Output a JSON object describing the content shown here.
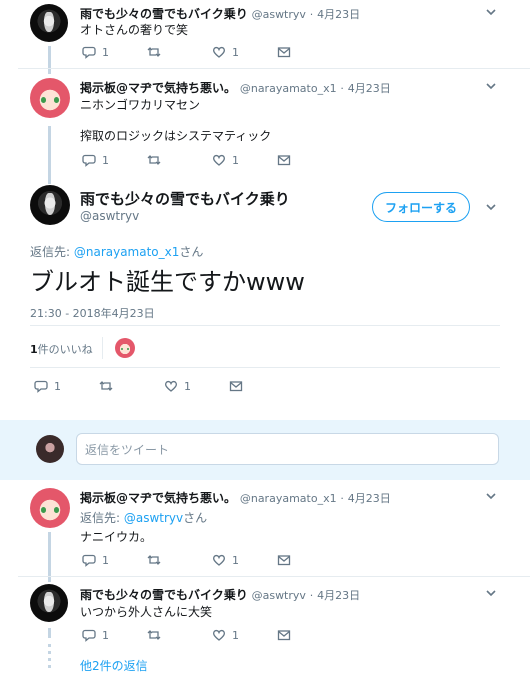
{
  "tweet1": {
    "name": "雨でも少々の雪でもバイク乗り",
    "handle": "@aswtryv",
    "date": "4月23日",
    "text": "オトさんの奢りで笑",
    "replies": "1",
    "likes": "1"
  },
  "tweet2": {
    "name": "掲示板@マヂで気持ち悪い。",
    "handle": "@narayamato_x1",
    "date": "4月23日",
    "line1": "ニホンゴワカリマセン",
    "line2": "搾取のロジックはシステマティック",
    "replies": "1",
    "likes": "1"
  },
  "main": {
    "name": "雨でも少々の雪でもバイク乗り",
    "handle": "@aswtryv",
    "follow": "フォローする",
    "reply_prefix": "返信先: ",
    "reply_to": "@narayamato_x1",
    "reply_suffix": "さん",
    "text": "ブルオト誕生ですかwww",
    "timestamp": "21:30 - 2018年4月23日",
    "likes_count": "1",
    "likes_label": "件のいいね",
    "replies": "1",
    "likes": "1"
  },
  "compose": {
    "placeholder": "返信をツイート"
  },
  "reply1": {
    "name": "掲示板@マヂで気持ち悪い。",
    "handle": "@narayamato_x1",
    "date": "4月23日",
    "reply_prefix": "返信先: ",
    "reply_to": "@aswtryv",
    "reply_suffix": "さん",
    "text": "ナニイウカ。",
    "replies": "1",
    "likes": "1"
  },
  "reply2": {
    "name": "雨でも少々の雪でもバイク乗り",
    "handle": "@aswtryv",
    "date": "4月23日",
    "text": "いつから外人さんに大笑",
    "replies": "1",
    "likes": "1"
  },
  "more_replies": "他2件の返信",
  "colors": {
    "accent": "#1da1f2",
    "muted": "#657786",
    "divider": "#e6ecf0",
    "thread": "#c4d5e3"
  }
}
